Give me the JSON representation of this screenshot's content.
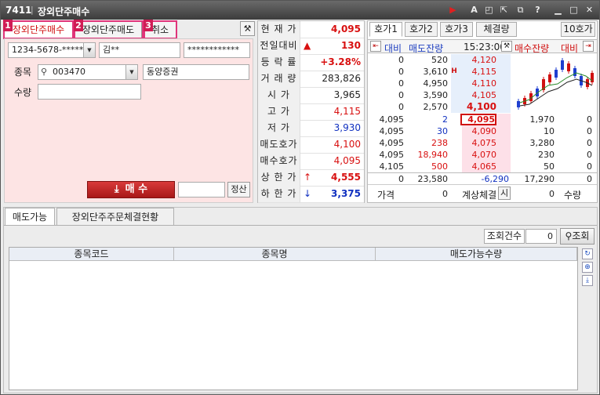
{
  "window": {
    "code": "7411",
    "title": "장외단주매수"
  },
  "titlebar_icons": [
    "play-icon",
    "font-icon",
    "popout-icon",
    "expand-icon",
    "restore-icon",
    "help-icon",
    "minimize-icon",
    "maximize-icon",
    "close-icon"
  ],
  "mode_tabs": [
    {
      "num": "1",
      "label": "장외단주매수"
    },
    {
      "num": "2",
      "label": "장외단주매도"
    },
    {
      "num": "3",
      "label": "취소"
    }
  ],
  "form": {
    "account": "1234-5678-*****",
    "name": "김**",
    "password": "************",
    "item_label": "종목",
    "item_code": "003470",
    "item_name": "동양증권",
    "qty_label": "수량",
    "qty_value": "",
    "buy_button": "매 수",
    "extra_input": "",
    "settle_button": "정산"
  },
  "quote": [
    {
      "label": "현 재 가",
      "value": "4,095",
      "color": "red",
      "arrow": ""
    },
    {
      "label": "전일대비",
      "value": "130",
      "color": "red",
      "arrow": "▲"
    },
    {
      "label": "등 락 률",
      "value": "+3.28%",
      "color": "red",
      "arrow": ""
    },
    {
      "label": "거 래 량",
      "value": "283,826",
      "color": "black",
      "arrow": ""
    },
    {
      "label": "시   가",
      "value": "3,965",
      "color": "black",
      "arrow": ""
    },
    {
      "label": "고   가",
      "value": "4,115",
      "color": "red",
      "arrow": ""
    },
    {
      "label": "저   가",
      "value": "3,930",
      "color": "blue",
      "arrow": ""
    },
    {
      "label": "매도호가",
      "value": "4,100",
      "color": "red",
      "arrow": ""
    },
    {
      "label": "매수호가",
      "value": "4,095",
      "color": "red",
      "arrow": ""
    },
    {
      "label": "상 한 가",
      "value": "4,555",
      "color": "red",
      "arrow": "↑"
    },
    {
      "label": "하 한 가",
      "value": "3,375",
      "color": "blue",
      "arrow": "↓"
    }
  ],
  "orderbook": {
    "tabs": [
      "호가1",
      "호가2",
      "호가3",
      "체결량"
    ],
    "ten_btn": "10호가",
    "hdr_compare": "대비",
    "hdr_ask_rem": "매도잔량",
    "time": "15:23:00",
    "hdr_bid_rem": "매수잔량",
    "hdr_compare2": "대비",
    "asks": [
      {
        "diff": "0",
        "qty": "520",
        "price": "4,120",
        "mark": ""
      },
      {
        "diff": "0",
        "qty": "3,610",
        "price": "4,115",
        "mark": "H"
      },
      {
        "diff": "0",
        "qty": "4,950",
        "price": "4,110",
        "mark": ""
      },
      {
        "diff": "0",
        "qty": "3,590",
        "price": "4,105",
        "mark": ""
      },
      {
        "diff": "0",
        "qty": "2,570",
        "price": "4,100",
        "mark": ""
      }
    ],
    "bids": [
      {
        "lp": "4,095",
        "lq": "2",
        "price": "4,095",
        "qty": "1,970",
        "diff": "0"
      },
      {
        "lp": "4,095",
        "lq": "30",
        "price": "4,090",
        "qty": "10",
        "diff": "0"
      },
      {
        "lp": "4,095",
        "lq": "238",
        "price": "4,075",
        "qty": "3,280",
        "diff": "0"
      },
      {
        "lp": "4,095",
        "lq": "18,940",
        "price": "4,070",
        "qty": "230",
        "diff": "0"
      },
      {
        "lp": "4,105",
        "lq": "500",
        "price": "4,065",
        "qty": "50",
        "diff": "0"
      }
    ],
    "totals": {
      "diff": "0",
      "ask": "23,580",
      "net": "-6,290",
      "bid": "17,290",
      "diff2": "0"
    },
    "footer": {
      "price_label": "가격",
      "price": "0",
      "calc_label": "계상체결",
      "calc_btn": "시",
      "qty": "0",
      "qty_label": "수량"
    }
  },
  "bottom": {
    "tabs": [
      "매도가능",
      "장외단주주문체결현황"
    ],
    "count_label": "조회건수",
    "count_value": "0",
    "query_button": "조회",
    "columns": [
      "종목코드",
      "종목명",
      "매도가능수량"
    ]
  },
  "colors": {
    "pink_panel": "#fde4e4",
    "red": "#d81010",
    "blue": "#1030c0",
    "highlight": "#e0357a"
  }
}
